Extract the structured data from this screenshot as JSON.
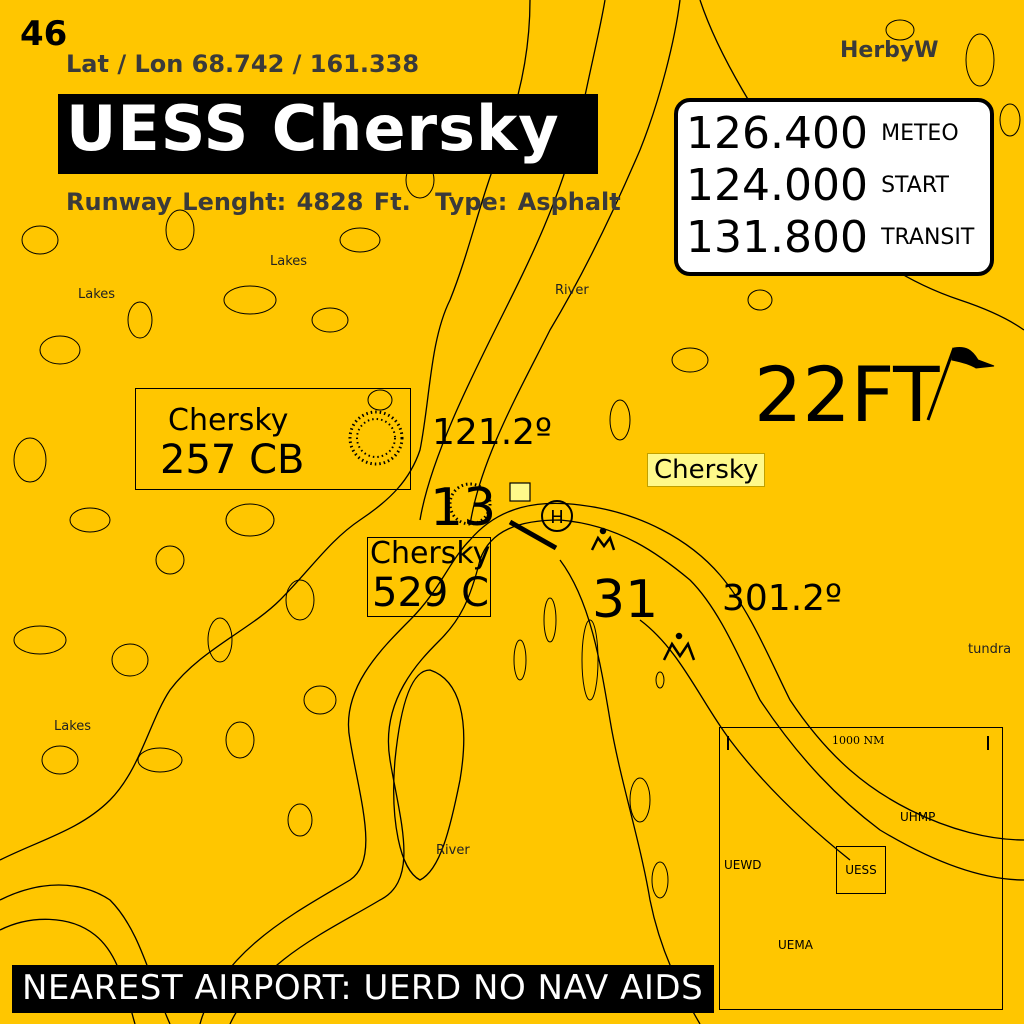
{
  "page_number": "46",
  "lat_lon": "Lat / Lon 68.742 / 161.338",
  "author": "HerbyW",
  "airport_title": "UESS Chersky",
  "runway_length_label": "Runway Lenght:",
  "runway_length_value": "4828 Ft.",
  "runway_type_label": "Type:",
  "runway_type_value": "Asphalt",
  "frequencies": [
    {
      "freq": "126.400",
      "name": "METEO"
    },
    {
      "freq": "124.000",
      "name": "START"
    },
    {
      "freq": "131.800",
      "name": "TRANSIT"
    }
  ],
  "elevation": "22FT",
  "navaids": [
    {
      "name": "Chersky",
      "freq": "257 CB"
    },
    {
      "name": "Chersky",
      "freq": "529 C"
    }
  ],
  "runway_headings": {
    "heading_13": "121.2º",
    "heading_31": "301.2º",
    "end_13": "13",
    "end_31": "31"
  },
  "town_label": "Chersky",
  "map_labels": {
    "lakes": "Lakes",
    "river": "River",
    "tundra": "tundra"
  },
  "inset": {
    "scale_label": "1000 NM",
    "current": "UESS",
    "airports": [
      "UHMP",
      "UEWD",
      "UEMA"
    ]
  },
  "nearest_airport": "NEAREST  AIRPORT: UERD NO NAV AIDS"
}
